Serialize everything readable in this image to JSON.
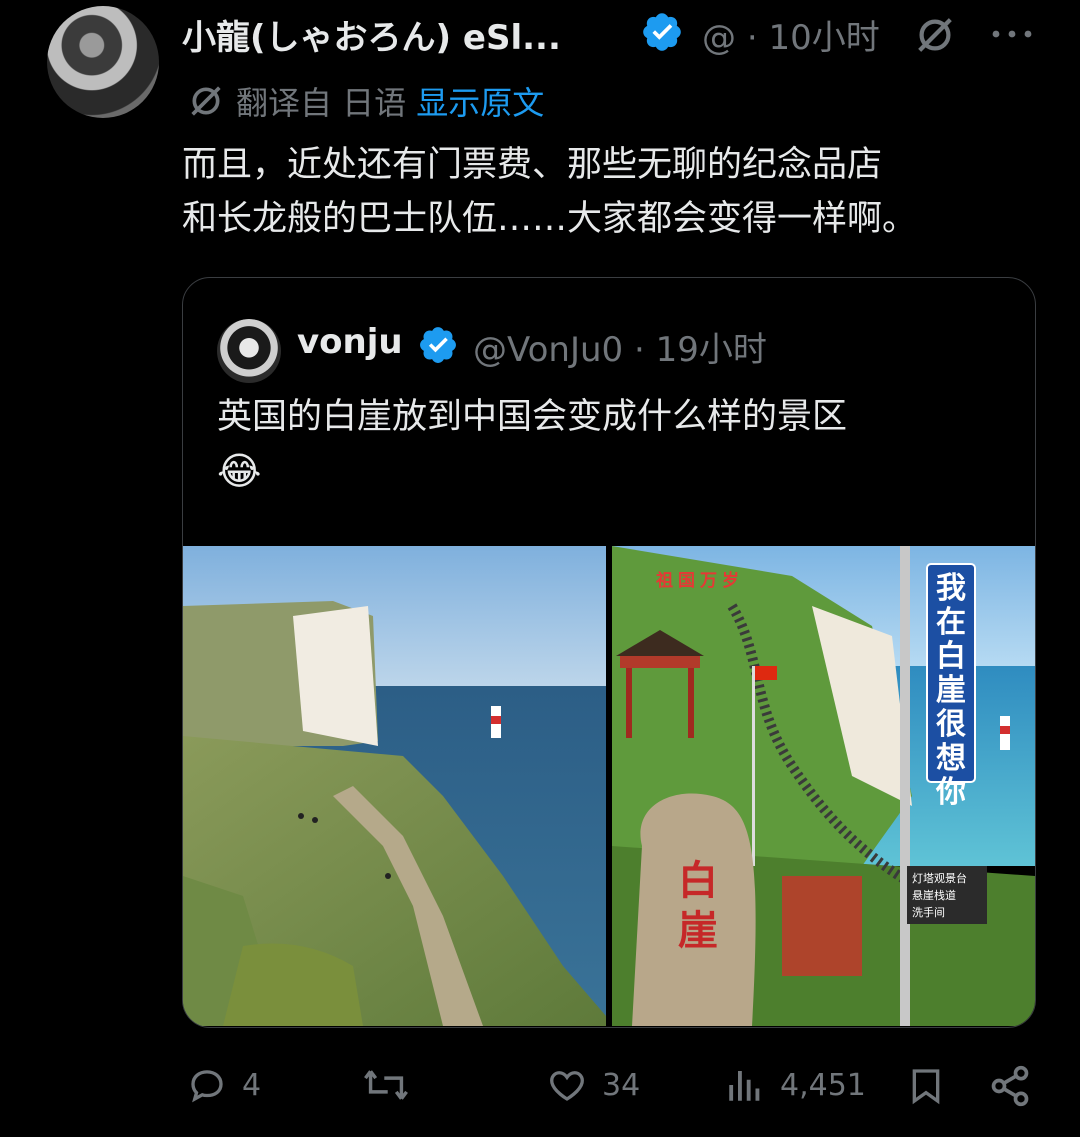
{
  "tweet": {
    "author_name": "小龍(しゃおろん) eSl...",
    "handle": "@",
    "separator": "·",
    "time": "10小时",
    "translate_label": "翻译自 日语",
    "show_original": "显示原文",
    "body_line1": "而且，近处还有门票费、那些无聊的纪念品店",
    "body_line2": "和长龙般的巴士队伍……大家都会变得一样啊。"
  },
  "quote": {
    "author_name": "vonju",
    "handle": "@VonJu0",
    "separator": "·",
    "time": "19小时",
    "text": "英国的白崖放到中国会变成什么样的景区",
    "emoji": "😂",
    "photo_right": {
      "banner": "祖国万岁",
      "sign_vertical": "我在白崖很想你",
      "stone": "白崖",
      "signpost": [
        "灯塔观景台",
        "悬崖栈道",
        "洗手间"
      ]
    }
  },
  "actions": {
    "replies": "4",
    "likes": "34",
    "views": "4,451"
  },
  "colors": {
    "background": "#000000",
    "text": "#e7e9ea",
    "muted": "#71767b",
    "link": "#1d9bf0",
    "verified": "#1d9bf0"
  },
  "icons": [
    "verified-badge-icon",
    "translate-icon",
    "more-icon",
    "reply-icon",
    "retweet-icon",
    "like-icon",
    "views-icon",
    "bookmark-icon",
    "share-icon"
  ]
}
